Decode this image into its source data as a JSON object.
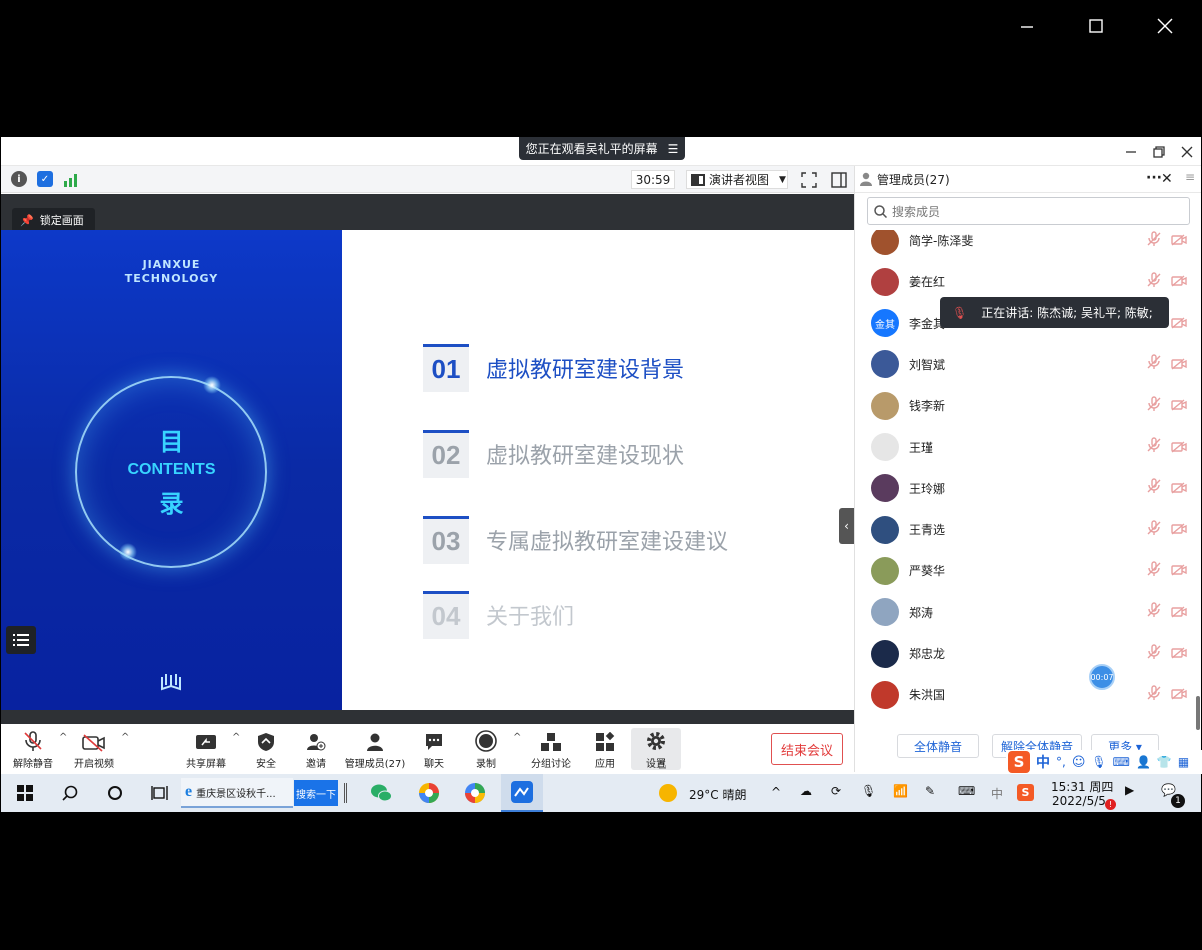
{
  "outer": {
    "controls": [
      "minimize",
      "maximize",
      "close"
    ]
  },
  "banner": {
    "text": "您正在观看吴礼平的屏幕"
  },
  "toolbar": {
    "timer": "30:59",
    "view_label": "演讲者视图"
  },
  "share": {
    "lock_label": "锁定画面",
    "slide": {
      "brand_line1": "JIANXUE",
      "brand_line2": "TECHNOLOGY",
      "char_top": "目",
      "contents": "CONTENTS",
      "char_bottom": "录",
      "toc": [
        {
          "num": "01",
          "text": "虚拟教研室建设背景",
          "active": true
        },
        {
          "num": "02",
          "text": "虚拟教研室建设现状",
          "active": false
        },
        {
          "num": "03",
          "text": "专属虚拟教研室建设建议",
          "active": false
        },
        {
          "num": "04",
          "text": "关于我们",
          "active": false
        }
      ]
    }
  },
  "controls": {
    "unmute": "解除静音",
    "video": "开启视频",
    "share": "共享屏幕",
    "security": "安全",
    "invite": "邀请",
    "members": "管理成员(27)",
    "chat": "聊天",
    "record": "录制",
    "breakout": "分组讨论",
    "apps": "应用",
    "settings": "设置",
    "end": "结束会议"
  },
  "panel": {
    "title": "管理成员(27)",
    "search_placeholder": "搜索成员",
    "speaking": "正在讲话: 陈杰诚; 吴礼平; 陈敏;",
    "timer_bubble": "00:07",
    "members": [
      {
        "name": "简学-陈泽斐",
        "avatar_color": "#a0522d"
      },
      {
        "name": "姜在红",
        "avatar_color": "#b04040"
      },
      {
        "name": "李金其",
        "avatar_color": "#1677ff",
        "initials": "金其"
      },
      {
        "name": "刘智斌",
        "avatar_color": "#3b5998"
      },
      {
        "name": "钱李新",
        "avatar_color": "#b89a6a"
      },
      {
        "name": "王瑾",
        "avatar_color": "#e6e6e6"
      },
      {
        "name": "王玲娜",
        "avatar_color": "#5a3b5e"
      },
      {
        "name": "王青选",
        "avatar_color": "#2f4f7f"
      },
      {
        "name": "严葵华",
        "avatar_color": "#8a9b5a"
      },
      {
        "name": "郑涛",
        "avatar_color": "#8fa5c0"
      },
      {
        "name": "郑忠龙",
        "avatar_color": "#1b2a4a"
      },
      {
        "name": "朱洪国",
        "avatar_color": "#c0392b"
      }
    ],
    "btn_mute_all": "全体静音",
    "btn_unmute_all": "解除全体静音",
    "btn_more": "更多 ▾"
  },
  "taskbar": {
    "ie_label": "重庆景区设秋千...",
    "search_btn": "搜索一下",
    "weather": "29°C  晴朗",
    "time": "15:31 周四",
    "date": "2022/5/5",
    "notif_count": "1",
    "ime_lang": "中"
  }
}
